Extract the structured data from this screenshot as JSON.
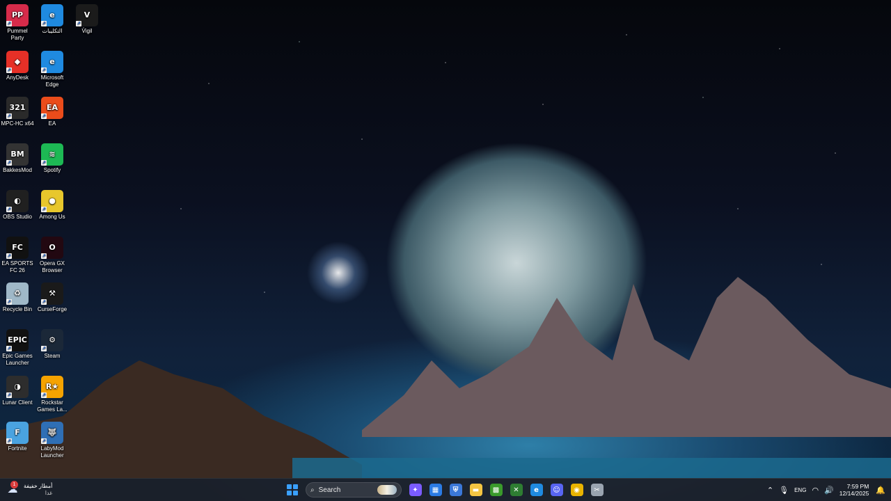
{
  "desktop": {
    "icons": [
      {
        "label": "Pummel Party",
        "icon": "pummel-party-icon",
        "color": "#d62b4a",
        "glyph": "PP"
      },
      {
        "label": "التكليبات",
        "icon": "edge-icon",
        "color": "#1f8ae0",
        "glyph": "e"
      },
      {
        "label": "Vigil",
        "icon": "vigil-icon",
        "color": "#1b1b1b",
        "glyph": "V"
      },
      {
        "label": "AnyDesk",
        "icon": "anydesk-icon",
        "color": "#e63027",
        "glyph": "◆"
      },
      {
        "label": "Microsoft Edge",
        "icon": "edge-icon",
        "color": "#1f8ae0",
        "glyph": "e"
      },
      {
        "label": "MPC-HC x64",
        "icon": "mpc-hc-icon",
        "color": "#2a2a2a",
        "glyph": "321"
      },
      {
        "label": "EA",
        "icon": "ea-icon",
        "color": "#ea4c1b",
        "glyph": "EA"
      },
      {
        "label": "BakkesMod",
        "icon": "bakkesmod-icon",
        "color": "#333333",
        "glyph": "BM"
      },
      {
        "label": "Spotify",
        "icon": "spotify-icon",
        "color": "#1db954",
        "glyph": "≋"
      },
      {
        "label": "OBS Studio",
        "icon": "obs-icon",
        "color": "#202020",
        "glyph": "◐"
      },
      {
        "label": "Among Us",
        "icon": "among-us-icon",
        "color": "#e8c72c",
        "glyph": "●"
      },
      {
        "label": "EA SPORTS FC 26",
        "icon": "fc26-icon",
        "color": "#111111",
        "glyph": "FC"
      },
      {
        "label": "Opera GX Browser",
        "icon": "opera-gx-icon",
        "color": "#220811",
        "glyph": "O"
      },
      {
        "label": "Recycle Bin",
        "icon": "recycle-bin-icon",
        "color": "#9fb8c8",
        "glyph": "♻"
      },
      {
        "label": "CurseForge",
        "icon": "curseforge-icon",
        "color": "#1a1a1a",
        "glyph": "⚒"
      },
      {
        "label": "Epic Games Launcher",
        "icon": "epic-games-icon",
        "color": "#111111",
        "glyph": "EPIC"
      },
      {
        "label": "Steam",
        "icon": "steam-icon",
        "color": "#1b2838",
        "glyph": "⚙"
      },
      {
        "label": "Lunar Client",
        "icon": "lunar-client-icon",
        "color": "#2d2d2d",
        "glyph": "◑"
      },
      {
        "label": "Rockstar Games La...",
        "icon": "rockstar-icon",
        "color": "#f5a300",
        "glyph": "R★"
      },
      {
        "label": "Fortnite",
        "icon": "fortnite-icon",
        "color": "#4aa3e0",
        "glyph": "F"
      },
      {
        "label": "LabyMod Launcher",
        "icon": "labymod-icon",
        "color": "#2f6fb5",
        "glyph": "🐺"
      }
    ]
  },
  "taskbar": {
    "weather": {
      "title": "أمطار خفيفة",
      "subtitle": "غدا",
      "badge": "1",
      "icon": "rain-cloud-icon"
    },
    "search": {
      "placeholder": "Search"
    },
    "apps": [
      {
        "name": "copilot-icon",
        "glyph": "✦",
        "color": "#7b5cff"
      },
      {
        "name": "microsoft-store-icon",
        "glyph": "▦",
        "color": "#2b7be4"
      },
      {
        "name": "security-shield-icon",
        "glyph": "⛨",
        "color": "#3b78d8"
      },
      {
        "name": "file-explorer-icon",
        "glyph": "▬",
        "color": "#f4c542"
      },
      {
        "name": "minecraft-icon",
        "glyph": "▩",
        "color": "#3a9a2b"
      },
      {
        "name": "xbox-app-icon",
        "glyph": "✕",
        "color": "#2e7d32"
      },
      {
        "name": "edge-icon",
        "glyph": "e",
        "color": "#1f8ae0"
      },
      {
        "name": "discord-icon",
        "glyph": "☺",
        "color": "#5865f2"
      },
      {
        "name": "chrome-icon",
        "glyph": "◉",
        "color": "#e9b300"
      },
      {
        "name": "snipping-tool-icon",
        "glyph": "✂",
        "color": "#9aa4b0"
      }
    ],
    "tray": {
      "language": "ENG",
      "time": "7:59 PM",
      "date": "12/14/2025"
    }
  }
}
